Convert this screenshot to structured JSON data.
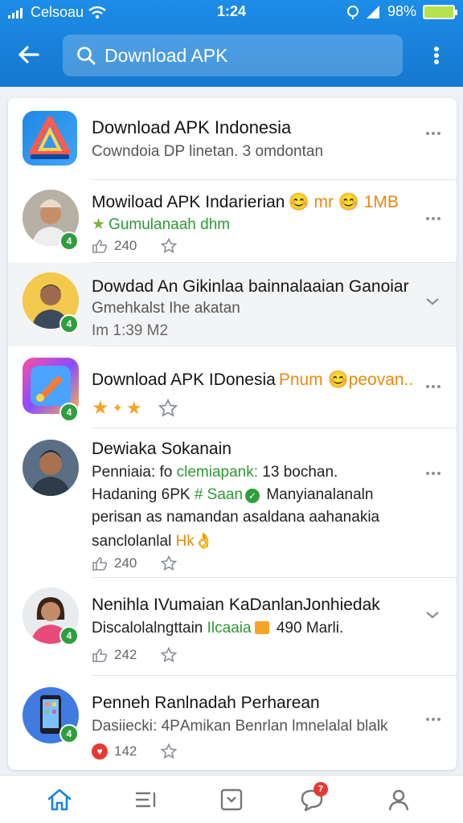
{
  "status_bar": {
    "carrier": "Celsoau",
    "time": "1:24",
    "battery": "98%"
  },
  "search": {
    "value": "Download APK"
  },
  "results": [
    {
      "title": "Download APK Indonesia",
      "subtitle": "Cowndoia DP linetan. 3 omdontan"
    },
    {
      "title": "Mowiload APK Indarierian",
      "title_extra": "😊 mr 😊 1MB",
      "subtitle": "Gumulanaah dhm",
      "likes": "240"
    },
    {
      "title": "Dowdad An Gikinlaa bainnalaaian Ganoiar",
      "subtitle": "Gmehkalst Ihe akatan",
      "time": "Im 1:39 M2"
    },
    {
      "title": "Download APK IDonesia",
      "title_extra": "Pnum 😊peovan.."
    },
    {
      "title": "Dewiaka Sokanain",
      "line1_a": "Penniaia: fo ",
      "line1_b": "clemiapank:",
      "line1_c": " 13 bochan.",
      "line2_a": "Hadaning 6PK ",
      "line2_b": "# Saan",
      "line2_c": " Manyianalanaln",
      "line3": "perisan as namandan asaldana aahanakia",
      "line4_a": "sanclolanlal ",
      "line4_b": "Hk👌",
      "likes": "240"
    },
    {
      "title": "Nenihla IVumaian KaDanlanJonhiedak",
      "line1_a": "Discalolalngttain ",
      "line1_b": "Ilcaaia",
      "line1_c": " 490 Marli.",
      "likes": "242"
    },
    {
      "title": "Penneh Ranlnadah Perharean",
      "subtitle": "Dasiiecki: 4PАmikan Benrlan lmnelalal blalk",
      "likes": "142"
    }
  ],
  "nav": {
    "notifications_count": "7"
  },
  "colors": {
    "header": "#1a84de",
    "accent_green": "#2c9a33",
    "accent_orange": "#e88a0c"
  }
}
